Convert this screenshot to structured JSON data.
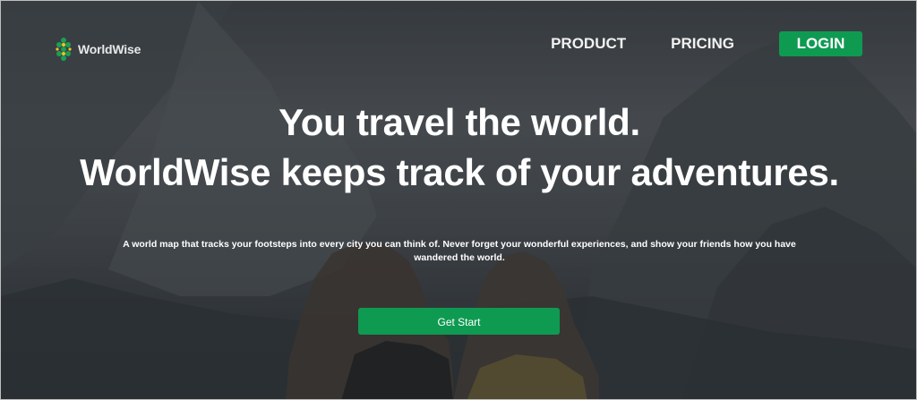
{
  "brand": {
    "name": "WorldWise",
    "logo_icon": "globe-hex-icon",
    "accent_color": "#0f9a52"
  },
  "nav": {
    "product": "PRODUCT",
    "pricing": "PRICING",
    "login": "LOGIN"
  },
  "hero": {
    "headline_line1": "You travel the world.",
    "headline_line2": "WorldWise keeps track of your adventures.",
    "description": "A world map that tracks your footsteps into every city you can think of. Never forget your wonderful experiences, and show your friends how you have wandered the world.",
    "cta_label": "Get Start"
  }
}
